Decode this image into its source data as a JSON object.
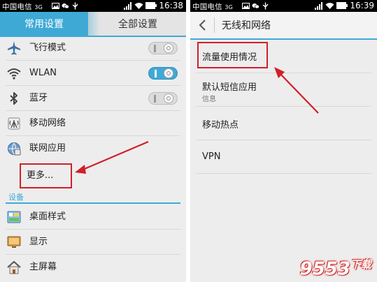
{
  "left": {
    "status": {
      "carrier": "中国电信",
      "network": "3G",
      "time": "16:38"
    },
    "tabs": {
      "common": "常用设置",
      "all": "全部设置"
    },
    "items": [
      {
        "label": "飞行模式",
        "icon": "airplane-icon",
        "toggle": "off"
      },
      {
        "label": "WLAN",
        "icon": "wifi-icon",
        "toggle": "on"
      },
      {
        "label": "蓝牙",
        "icon": "bluetooth-icon",
        "toggle": "off"
      },
      {
        "label": "移动网络",
        "icon": "mobile-network-icon"
      },
      {
        "label": "联网应用",
        "icon": "network-apps-icon"
      },
      {
        "label": "更多..."
      }
    ],
    "section_title": "设备",
    "device_items": [
      {
        "label": "桌面样式",
        "icon": "desktop-style-icon"
      },
      {
        "label": "显示",
        "icon": "display-icon"
      },
      {
        "label": "主屏幕",
        "icon": "home-screen-icon"
      }
    ]
  },
  "right": {
    "status": {
      "carrier": "中国电信",
      "network": "3G",
      "time": "16:39"
    },
    "title": "无线和网络",
    "items": [
      {
        "label": "流量使用情况"
      },
      {
        "label": "默认短信应用",
        "sub": "信息"
      },
      {
        "label": "移动热点"
      },
      {
        "label": "VPN"
      }
    ]
  },
  "watermark": {
    "text": "9553",
    "suffix": "下载"
  },
  "colors": {
    "accent": "#3fa9d6",
    "highlight": "#d0202a",
    "background": "#ededed"
  }
}
